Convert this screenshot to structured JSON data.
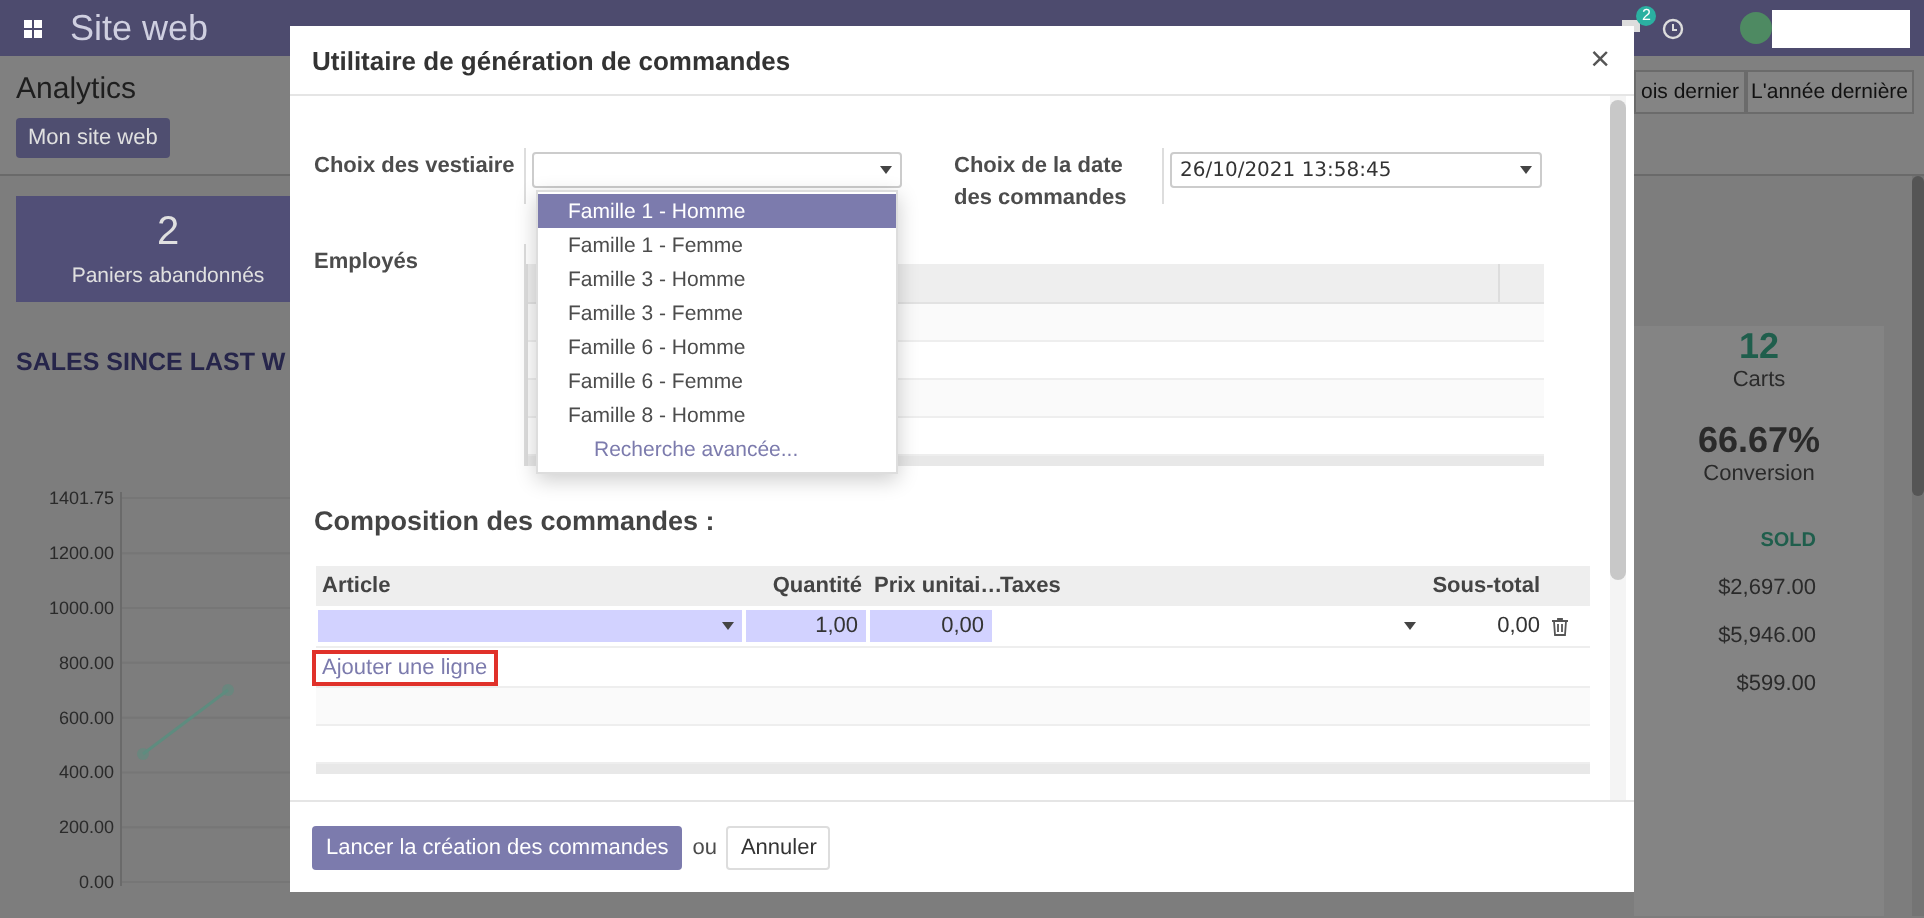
{
  "nav": {
    "app_title": "Site web",
    "message_count": "2"
  },
  "control_panel": {
    "title": "Analytics",
    "website_button": "Mon site web",
    "periods": [
      "ois dernier",
      "L'année dernière"
    ]
  },
  "kpi_card": {
    "value": "2",
    "label": "Paniers abandonnés"
  },
  "sales": {
    "title": "SALES SINCE LAST W",
    "chart_data": {
      "type": "line",
      "grid": true,
      "ylim": [
        0,
        1401.75
      ],
      "yticks": [
        {
          "value": 0,
          "label": "0.00"
        },
        {
          "value": 200,
          "label": "200.00"
        },
        {
          "value": 400,
          "label": "400.00"
        },
        {
          "value": 600,
          "label": "600.00"
        },
        {
          "value": 800,
          "label": "800.00"
        },
        {
          "value": 1000,
          "label": "1000.00"
        },
        {
          "value": 1200,
          "label": "1200.00"
        },
        {
          "value": 1401.75,
          "label": "1401.75"
        }
      ],
      "series": [
        {
          "color": "#5e8c7f",
          "marker": "circle",
          "values": [
            467,
            701
          ]
        }
      ]
    }
  },
  "stats": [
    {
      "value": "12",
      "label": "Carts"
    },
    {
      "value": "66.67%",
      "label": "Conversion"
    }
  ],
  "sold": {
    "heading": "SOLD",
    "amounts": [
      "$2,697.00",
      "$5,946.00",
      "$599.00"
    ]
  },
  "dialog": {
    "title": "Utilitaire de génération de commandes",
    "close": "×",
    "wardrobe_field": {
      "label": "Choix des vestiaire"
    },
    "date_field": {
      "label": "Choix de la date des commandes",
      "value": "26/10/2021 13:58:45"
    },
    "dropdown": {
      "options": [
        {
          "label": "Famille 1 - Homme",
          "selected": true
        },
        {
          "label": "Famille 1 - Femme",
          "selected": false
        },
        {
          "label": "Famille 3 - Homme",
          "selected": false
        },
        {
          "label": "Famille 3 - Femme",
          "selected": false
        },
        {
          "label": "Famille 6 - Homme",
          "selected": false
        },
        {
          "label": "Famille 6 - Femme",
          "selected": false
        },
        {
          "label": "Famille 8 - Homme",
          "selected": false
        }
      ],
      "advanced_search": "Recherche avancée..."
    },
    "employees": {
      "label": "Employés"
    },
    "composition": {
      "title": "Composition des commandes :",
      "columns": [
        "Article",
        "Quantité",
        "Prix unitai…",
        "Taxes",
        "Sous-total"
      ],
      "rows": [
        {
          "quantity": "1,00",
          "unit_price": "0,00",
          "subtotal": "0,00"
        }
      ],
      "add_line": {
        "label": "Ajouter une ligne",
        "highlighted": true
      }
    },
    "footer": {
      "submit": "Lancer la création des commandes",
      "separator": "ou",
      "cancel": "Annuler"
    }
  }
}
